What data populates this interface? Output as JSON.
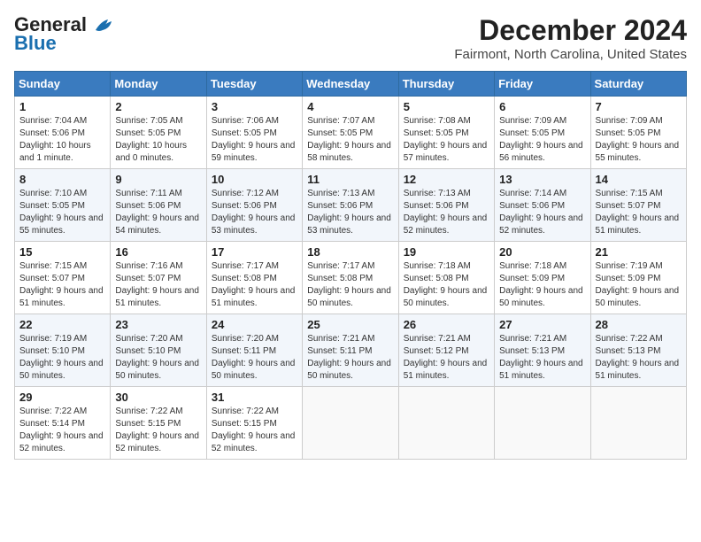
{
  "header": {
    "logo_line1": "General",
    "logo_line2": "Blue",
    "main_title": "December 2024",
    "subtitle": "Fairmont, North Carolina, United States"
  },
  "calendar": {
    "headers": [
      "Sunday",
      "Monday",
      "Tuesday",
      "Wednesday",
      "Thursday",
      "Friday",
      "Saturday"
    ],
    "weeks": [
      [
        {
          "day": "1",
          "info": "Sunrise: 7:04 AM\nSunset: 5:06 PM\nDaylight: 10 hours and 1 minute."
        },
        {
          "day": "2",
          "info": "Sunrise: 7:05 AM\nSunset: 5:05 PM\nDaylight: 10 hours and 0 minutes."
        },
        {
          "day": "3",
          "info": "Sunrise: 7:06 AM\nSunset: 5:05 PM\nDaylight: 9 hours and 59 minutes."
        },
        {
          "day": "4",
          "info": "Sunrise: 7:07 AM\nSunset: 5:05 PM\nDaylight: 9 hours and 58 minutes."
        },
        {
          "day": "5",
          "info": "Sunrise: 7:08 AM\nSunset: 5:05 PM\nDaylight: 9 hours and 57 minutes."
        },
        {
          "day": "6",
          "info": "Sunrise: 7:09 AM\nSunset: 5:05 PM\nDaylight: 9 hours and 56 minutes."
        },
        {
          "day": "7",
          "info": "Sunrise: 7:09 AM\nSunset: 5:05 PM\nDaylight: 9 hours and 55 minutes."
        }
      ],
      [
        {
          "day": "8",
          "info": "Sunrise: 7:10 AM\nSunset: 5:05 PM\nDaylight: 9 hours and 55 minutes."
        },
        {
          "day": "9",
          "info": "Sunrise: 7:11 AM\nSunset: 5:06 PM\nDaylight: 9 hours and 54 minutes."
        },
        {
          "day": "10",
          "info": "Sunrise: 7:12 AM\nSunset: 5:06 PM\nDaylight: 9 hours and 53 minutes."
        },
        {
          "day": "11",
          "info": "Sunrise: 7:13 AM\nSunset: 5:06 PM\nDaylight: 9 hours and 53 minutes."
        },
        {
          "day": "12",
          "info": "Sunrise: 7:13 AM\nSunset: 5:06 PM\nDaylight: 9 hours and 52 minutes."
        },
        {
          "day": "13",
          "info": "Sunrise: 7:14 AM\nSunset: 5:06 PM\nDaylight: 9 hours and 52 minutes."
        },
        {
          "day": "14",
          "info": "Sunrise: 7:15 AM\nSunset: 5:07 PM\nDaylight: 9 hours and 51 minutes."
        }
      ],
      [
        {
          "day": "15",
          "info": "Sunrise: 7:15 AM\nSunset: 5:07 PM\nDaylight: 9 hours and 51 minutes."
        },
        {
          "day": "16",
          "info": "Sunrise: 7:16 AM\nSunset: 5:07 PM\nDaylight: 9 hours and 51 minutes."
        },
        {
          "day": "17",
          "info": "Sunrise: 7:17 AM\nSunset: 5:08 PM\nDaylight: 9 hours and 51 minutes."
        },
        {
          "day": "18",
          "info": "Sunrise: 7:17 AM\nSunset: 5:08 PM\nDaylight: 9 hours and 50 minutes."
        },
        {
          "day": "19",
          "info": "Sunrise: 7:18 AM\nSunset: 5:08 PM\nDaylight: 9 hours and 50 minutes."
        },
        {
          "day": "20",
          "info": "Sunrise: 7:18 AM\nSunset: 5:09 PM\nDaylight: 9 hours and 50 minutes."
        },
        {
          "day": "21",
          "info": "Sunrise: 7:19 AM\nSunset: 5:09 PM\nDaylight: 9 hours and 50 minutes."
        }
      ],
      [
        {
          "day": "22",
          "info": "Sunrise: 7:19 AM\nSunset: 5:10 PM\nDaylight: 9 hours and 50 minutes."
        },
        {
          "day": "23",
          "info": "Sunrise: 7:20 AM\nSunset: 5:10 PM\nDaylight: 9 hours and 50 minutes."
        },
        {
          "day": "24",
          "info": "Sunrise: 7:20 AM\nSunset: 5:11 PM\nDaylight: 9 hours and 50 minutes."
        },
        {
          "day": "25",
          "info": "Sunrise: 7:21 AM\nSunset: 5:11 PM\nDaylight: 9 hours and 50 minutes."
        },
        {
          "day": "26",
          "info": "Sunrise: 7:21 AM\nSunset: 5:12 PM\nDaylight: 9 hours and 51 minutes."
        },
        {
          "day": "27",
          "info": "Sunrise: 7:21 AM\nSunset: 5:13 PM\nDaylight: 9 hours and 51 minutes."
        },
        {
          "day": "28",
          "info": "Sunrise: 7:22 AM\nSunset: 5:13 PM\nDaylight: 9 hours and 51 minutes."
        }
      ],
      [
        {
          "day": "29",
          "info": "Sunrise: 7:22 AM\nSunset: 5:14 PM\nDaylight: 9 hours and 52 minutes."
        },
        {
          "day": "30",
          "info": "Sunrise: 7:22 AM\nSunset: 5:15 PM\nDaylight: 9 hours and 52 minutes."
        },
        {
          "day": "31",
          "info": "Sunrise: 7:22 AM\nSunset: 5:15 PM\nDaylight: 9 hours and 52 minutes."
        },
        null,
        null,
        null,
        null
      ]
    ]
  }
}
